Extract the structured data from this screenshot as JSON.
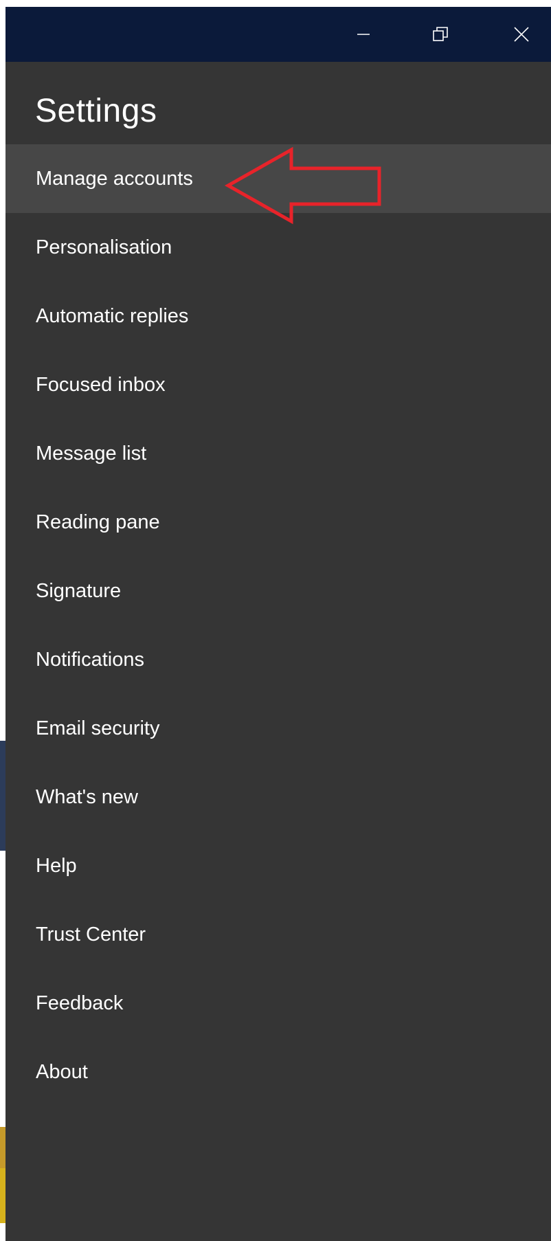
{
  "window": {
    "title_bar_color": "#0b1a3a",
    "background_color": "#353535",
    "controls": {
      "minimize_icon": "minimize-icon",
      "restore_icon": "restore-icon",
      "close_icon": "close-icon"
    }
  },
  "settings": {
    "title": "Settings",
    "selected_color": "#474747",
    "items": [
      {
        "label": "Manage accounts",
        "selected": true
      },
      {
        "label": "Personalisation"
      },
      {
        "label": "Automatic replies"
      },
      {
        "label": "Focused inbox"
      },
      {
        "label": "Message list"
      },
      {
        "label": "Reading pane"
      },
      {
        "label": "Signature"
      },
      {
        "label": "Notifications"
      },
      {
        "label": "Email security"
      },
      {
        "label": "What's new"
      },
      {
        "label": "Help"
      },
      {
        "label": "Trust Center"
      },
      {
        "label": "Feedback"
      },
      {
        "label": "About"
      }
    ]
  },
  "annotation": {
    "icon": "red-arrow-pointer-icon",
    "color": "#e8232a"
  }
}
